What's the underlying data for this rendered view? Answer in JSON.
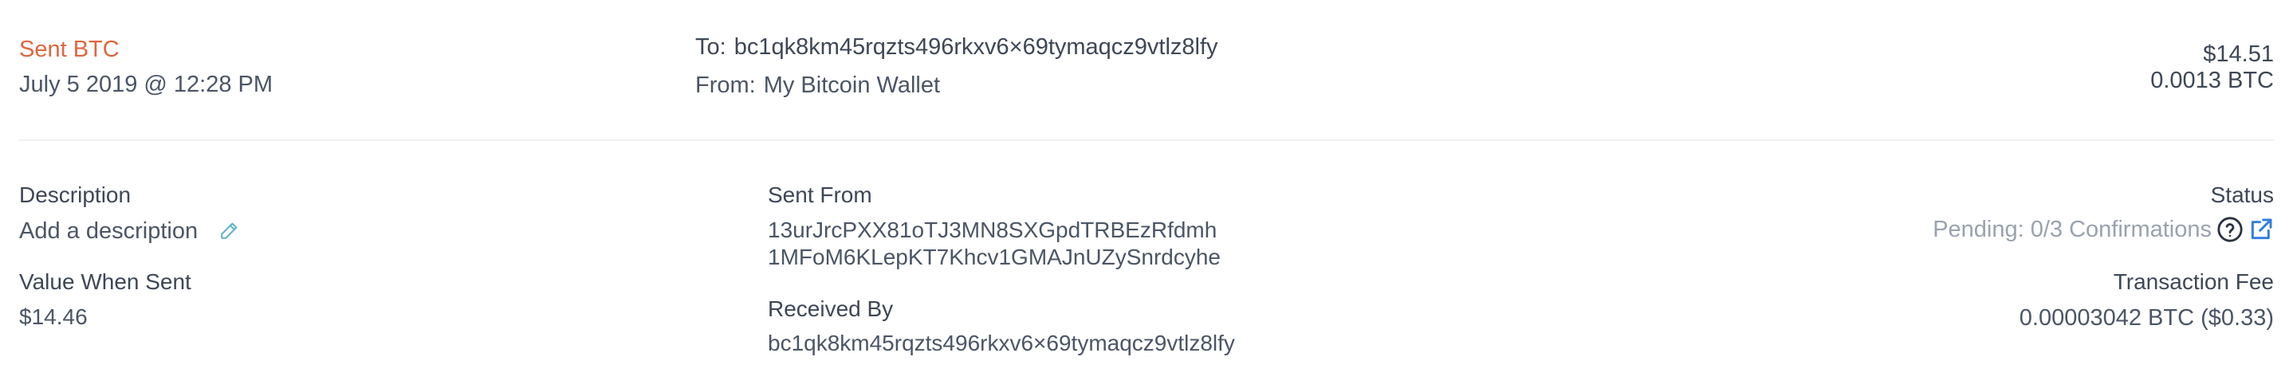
{
  "header": {
    "type_label": "Sent BTC",
    "date": "July 5 2019 @ 12:28 PM",
    "to_label": "To:",
    "to_address": "bc1qk8km45rqzts496rkxv6×69tymaqcz9vtlz8lfy",
    "from_label": "From:",
    "from_value": "My Bitcoin Wallet",
    "fiat_amount": "$14.51",
    "btc_amount": "0.0013 BTC"
  },
  "details": {
    "description_label": "Description",
    "description_placeholder": "Add a description",
    "value_when_sent_label": "Value When Sent",
    "value_when_sent": "$14.46",
    "sent_from_label": "Sent From",
    "sent_from_addresses": [
      "13urJrcPXX81oTJ3MN8SXGpdTRBEzRfdmh",
      "1MFoM6KLepKT7Khcv1GMAJnUZySnrdcyhe"
    ],
    "received_by_label": "Received By",
    "received_by_address": "bc1qk8km45rqzts496rkxv6×69tymaqcz9vtlz8lfy",
    "status_label": "Status",
    "status_value": "Pending: 0/3 Confirmations",
    "transaction_fee_label": "Transaction Fee",
    "transaction_fee_value": "0.00003042 BTC ($0.33)"
  },
  "icons": {
    "edit": "pencil-icon",
    "help": "question-circle-icon",
    "external": "external-link-icon"
  },
  "colors": {
    "accent_red": "#e0663f",
    "link_blue": "#2f7de1",
    "edit_teal": "#5fb3c7"
  }
}
